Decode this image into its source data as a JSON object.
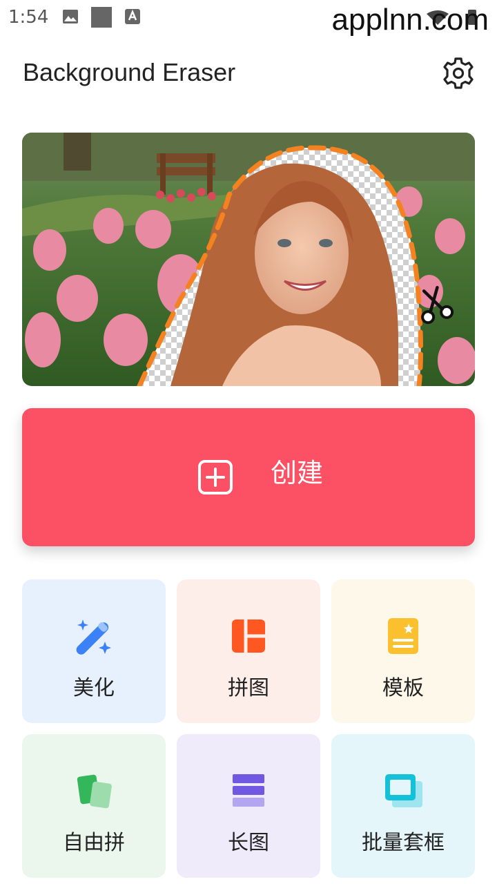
{
  "status_bar": {
    "time": "1:54",
    "watermark": "applnn.com",
    "icons": [
      "image-icon",
      "square-icon",
      "text-a-icon",
      "wifi-icon",
      "battery-icon"
    ]
  },
  "header": {
    "title": "Background Eraser",
    "settings_icon": "gear-icon"
  },
  "hero": {
    "icon": "scissors-icon"
  },
  "create": {
    "label": "创建",
    "icon": "plus-square-icon",
    "color": "#fc5064"
  },
  "tiles": [
    {
      "label": "美化",
      "icon": "magic-wand-icon",
      "bg": "#e7f0fd",
      "accent": "#3b82f6"
    },
    {
      "label": "拼图",
      "icon": "collage-grid-icon",
      "bg": "#fdeee9",
      "accent": "#ff5722"
    },
    {
      "label": "模板",
      "icon": "template-card-icon",
      "bg": "#fdf8ea",
      "accent": "#fbc02d"
    },
    {
      "label": "自由拼",
      "icon": "free-collage-icon",
      "bg": "#ebf7ed",
      "accent": "#34b65a"
    },
    {
      "label": "长图",
      "icon": "long-image-icon",
      "bg": "#efebfb",
      "accent": "#7158e2"
    },
    {
      "label": "批量套框",
      "icon": "batch-frame-icon",
      "bg": "#e5f6fa",
      "accent": "#14c1d8"
    }
  ]
}
